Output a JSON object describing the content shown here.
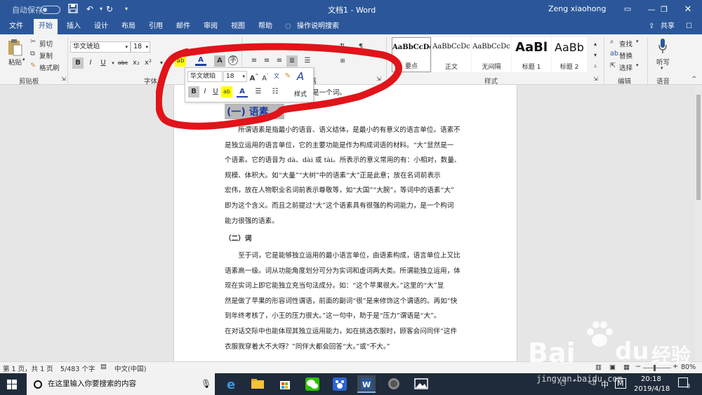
{
  "titlebar": {
    "autosave_label": "自动保存",
    "autosave_toggle": "关",
    "doc_title": "文档1 - Word",
    "user_name": "Zeng xiaohong",
    "qa_icons": [
      "save-icon",
      "undo-icon",
      "redo-icon",
      "customize-icon"
    ]
  },
  "tabs": [
    {
      "label": "文件"
    },
    {
      "label": "开始",
      "active": true
    },
    {
      "label": "插入"
    },
    {
      "label": "设计"
    },
    {
      "label": "布局"
    },
    {
      "label": "引用"
    },
    {
      "label": "邮件"
    },
    {
      "label": "审阅"
    },
    {
      "label": "视图"
    },
    {
      "label": "帮助"
    },
    {
      "label": "操作说明搜索"
    }
  ],
  "share_label": "共享",
  "ribbon": {
    "clipboard": {
      "paste": "粘贴",
      "cut": "剪切",
      "copy": "复制",
      "format_painter": "格式刷",
      "group": "剪贴板"
    },
    "font": {
      "family": "华文琥珀",
      "size": "18",
      "group": "字体"
    },
    "paragraph": {
      "group": "段落"
    },
    "styles": {
      "items": [
        {
          "sample": "AaBbCcDd",
          "name": "要点"
        },
        {
          "sample": "AaBbCcDc",
          "name": "正文"
        },
        {
          "sample": "AaBbCcDc",
          "name": "无间隔"
        },
        {
          "sample": "AaBl",
          "name": "标题 1"
        },
        {
          "sample": "AaBb",
          "name": "标题 2"
        }
      ],
      "group": "样式"
    },
    "editing": {
      "find": "查找",
      "replace": "替换",
      "select": "选择",
      "group": "编辑"
    },
    "voice": {
      "dictate": "听写",
      "group": "语音"
    }
  },
  "mini_toolbar": {
    "font": "华文琥珀",
    "size": "18",
    "styles": "样式"
  },
  "document": {
    "line0": "是一个词。",
    "heading": "(一) 语素",
    "para1": [
      "所谓语素是指最小的语音、语义结体，是最小的有意义的语言单位。语素不",
      "是独立运用的语言单位，它的主要功能是作为构成词语的材料。“大”显然是一",
      "个语素。它的语音为 dà、dài 或 tài。所表示的意义常用的有：小相对，数量、",
      "规模、体积大。如“大量”“大树”中的语素“大”正是此意；放在名词前表示",
      "宏伟，放在人物职业名词前表示尊敬等，如“大国”“大腕”，等词中的语素“大”",
      "即为这个含义。而且之前提过“大”这个语素具有很强的构词能力，是一个构词",
      "能力很强的语素。"
    ],
    "heading2": "（二）词",
    "para2": [
      "至于词，它是能够独立运用的最小语言单位，由语素构成，语言单位上又比",
      "语素高一级。词从功能角度划分可分为实词和虚词两大类。所谓能独立运用，体",
      "现在实词上即它能独立充当句法成分。如：“这个苹果很大。”这里的“大”显",
      "然是做了苹果的形容词性谓语，前面的副词“很”是来修饰这个谓语的。再如“快",
      "到年终考核了，小王的压力很大。”这一句中，助于是“压力”谓语是“大”。",
      "在对话交际中也能体现其独立运用能力，如在挑选衣服时，顾客会问同伴“这件",
      "衣服我穿着大不大呀？”同伴大都会回答“大。”或“不大。”"
    ]
  },
  "status": {
    "page": "第 1 页，共 1 页",
    "words": "5/483 个字",
    "lang": "中文(中国)",
    "zoom": "80%"
  },
  "taskbar": {
    "search_placeholder": "在这里输入你要搜索的内容",
    "ime": "中",
    "ime2": "M",
    "time": "20:18",
    "date": "2019/4/18",
    "notify_count": "3"
  },
  "watermark": {
    "brand": "Bai",
    "brand2": "du",
    "cn": "经验",
    "url": "jingyan.baidu.com"
  },
  "colors": {
    "accent": "#2b579a",
    "marker": "#e0141a",
    "taskbar": "#1f2b3a",
    "highlight": "#ffff00",
    "fontcolor": "#1f3f9f"
  }
}
